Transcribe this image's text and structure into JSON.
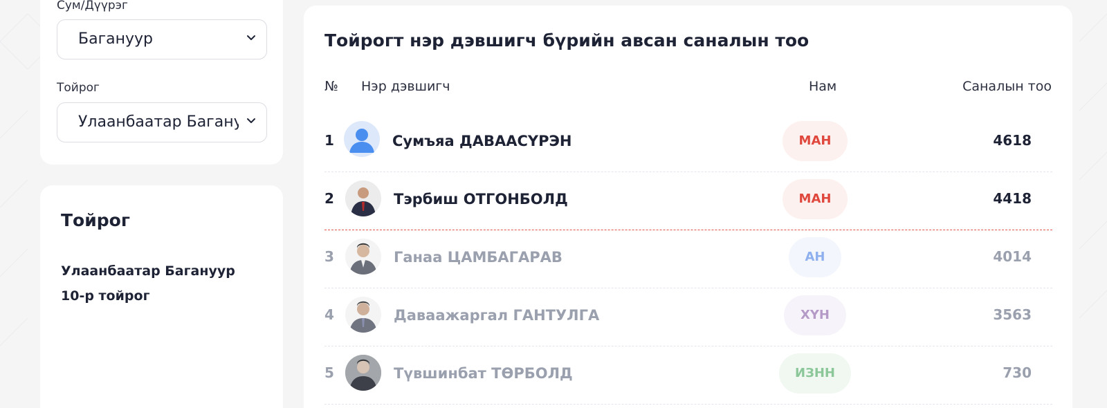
{
  "filters": {
    "district_label": "Сум/Дүүрэг",
    "district_value": "Багануур",
    "constituency_label": "Тойрог",
    "constituency_value": "Улаанбаатар Багануур"
  },
  "info": {
    "title": "Тойрог",
    "line1": "Улаанбаатар Багануур",
    "line2": "10-р тойрог"
  },
  "results": {
    "title": "Тойрогт нэр дэвшигч бүрийн авсан саналын тоо",
    "headers": {
      "num": "№",
      "candidate": "Нэр дэвшигч",
      "party": "Нам",
      "votes": "Саналын тоо"
    },
    "rows": [
      {
        "num": "1",
        "name": "Сумъяа ДАВААСҮРЭН",
        "party": "МАН",
        "votes": "4618",
        "avatar": "default-user-icon",
        "party_color": "#e0473c",
        "party_bg": "#fdf1ef"
      },
      {
        "num": "2",
        "name": "Тэрбиш ОТГОНБОЛД",
        "party": "МАН",
        "votes": "4418",
        "avatar": "candidate-photo",
        "party_color": "#e0473c",
        "party_bg": "#fdf1ef"
      },
      {
        "num": "3",
        "name": "Ганаа ЦАМБАГАРАВ",
        "party": "АН",
        "votes": "4014",
        "avatar": "candidate-photo",
        "party_color": "#8fb0ee",
        "party_bg": "#f3f6fd"
      },
      {
        "num": "4",
        "name": "Даваажаргал ГАНТУЛГА",
        "party": "ХҮН",
        "votes": "3563",
        "avatar": "candidate-photo",
        "party_color": "#b59ac8",
        "party_bg": "#f7f3fa"
      },
      {
        "num": "5",
        "name": "Түвшинбат ТӨРБОЛД",
        "party": "ИЗНН",
        "votes": "730",
        "avatar": "candidate-photo",
        "party_color": "#8cc79a",
        "party_bg": "#f1f8f2"
      }
    ]
  }
}
